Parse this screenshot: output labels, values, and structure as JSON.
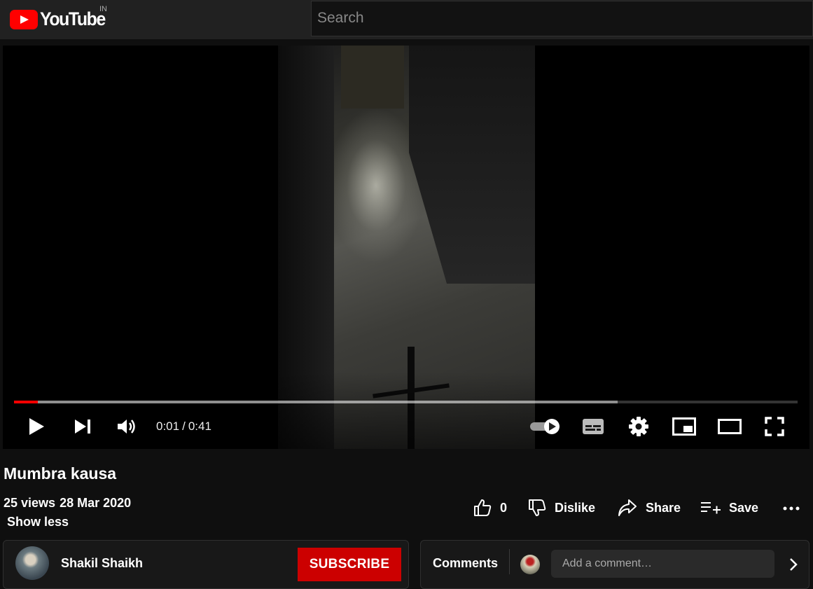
{
  "header": {
    "logo_text": "YouTube",
    "region": "IN",
    "search_placeholder": "Search"
  },
  "player": {
    "current_time": "0:01",
    "separator": "/",
    "duration": "0:41",
    "played_fraction": 0.03,
    "buffered_fraction": 0.77,
    "autoplay": "on"
  },
  "video": {
    "title": "Mumbra kausa",
    "views": "25 views",
    "date": "28 Mar 2020",
    "show_less": "Show less"
  },
  "actions": {
    "like_count": "0",
    "dislike_label": "Dislike",
    "share_label": "Share",
    "save_label": "Save"
  },
  "channel": {
    "name": "Shakil Shaikh",
    "subscribe_label": "SUBSCRIBE"
  },
  "comments": {
    "label": "Comments",
    "placeholder": "Add a comment…"
  },
  "colors": {
    "brand": "#ff0000",
    "subscribe": "#cc0000",
    "background": "#0f0f0f"
  }
}
